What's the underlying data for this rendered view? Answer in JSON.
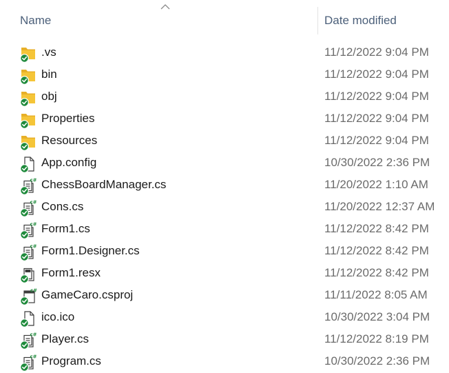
{
  "header": {
    "name_label": "Name",
    "date_label": "Date modified",
    "sort_direction": "ascending"
  },
  "colors": {
    "folder": "#f5c538",
    "sync_badge": "#1e8a3b",
    "header_text": "#4c607a"
  },
  "files": [
    {
      "name": ".vs",
      "date": "11/12/2022 9:04 PM",
      "icon": "folder-icon"
    },
    {
      "name": "bin",
      "date": "11/12/2022 9:04 PM",
      "icon": "folder-icon"
    },
    {
      "name": "obj",
      "date": "11/12/2022 9:04 PM",
      "icon": "folder-icon"
    },
    {
      "name": "Properties",
      "date": "11/12/2022 9:04 PM",
      "icon": "folder-icon"
    },
    {
      "name": "Resources",
      "date": "11/12/2022 9:04 PM",
      "icon": "folder-icon"
    },
    {
      "name": "App.config",
      "date": "10/30/2022 2:36 PM",
      "icon": "config-file-icon"
    },
    {
      "name": "ChessBoardManager.cs",
      "date": "11/20/2022 1:10 AM",
      "icon": "csharp-file-icon"
    },
    {
      "name": "Cons.cs",
      "date": "11/20/2022 12:37 AM",
      "icon": "csharp-file-icon"
    },
    {
      "name": "Form1.cs",
      "date": "11/12/2022 8:42 PM",
      "icon": "csharp-file-icon"
    },
    {
      "name": "Form1.Designer.cs",
      "date": "11/12/2022 8:42 PM",
      "icon": "csharp-file-icon"
    },
    {
      "name": "Form1.resx",
      "date": "11/12/2022 8:42 PM",
      "icon": "resx-file-icon"
    },
    {
      "name": "GameCaro.csproj",
      "date": "11/11/2022 8:05 AM",
      "icon": "csproj-file-icon"
    },
    {
      "name": "ico.ico",
      "date": "10/30/2022 3:04 PM",
      "icon": "blank-file-icon"
    },
    {
      "name": "Player.cs",
      "date": "11/12/2022 8:19 PM",
      "icon": "csharp-file-icon"
    },
    {
      "name": "Program.cs",
      "date": "10/30/2022 2:36 PM",
      "icon": "csharp-file-icon"
    }
  ]
}
